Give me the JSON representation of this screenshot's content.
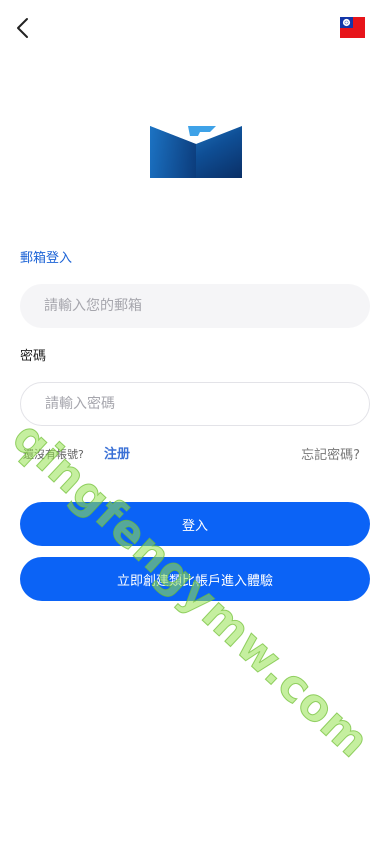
{
  "header": {
    "back_icon": "chevron-left-icon",
    "flag_icon": "taiwan-flag-icon"
  },
  "brand": {
    "logo_icon": "brand-logo-icon"
  },
  "email_section": {
    "label": "郵箱登入",
    "placeholder": "請輸入您的郵箱"
  },
  "password_section": {
    "label": "密碼",
    "placeholder": "請輸入密碼"
  },
  "links": {
    "no_account": "還沒有帳號?",
    "register": "注册",
    "forgot_password": "忘記密碼?"
  },
  "buttons": {
    "login": "登入",
    "demo_account": "立即創建類比帳戶進入體驗"
  },
  "watermark": {
    "text": "qingfengymw.com"
  },
  "colors": {
    "primary": "#0b63f6",
    "link_blue": "#1c63d6",
    "input_bg": "#f5f5f7",
    "watermark": "#96e250"
  }
}
